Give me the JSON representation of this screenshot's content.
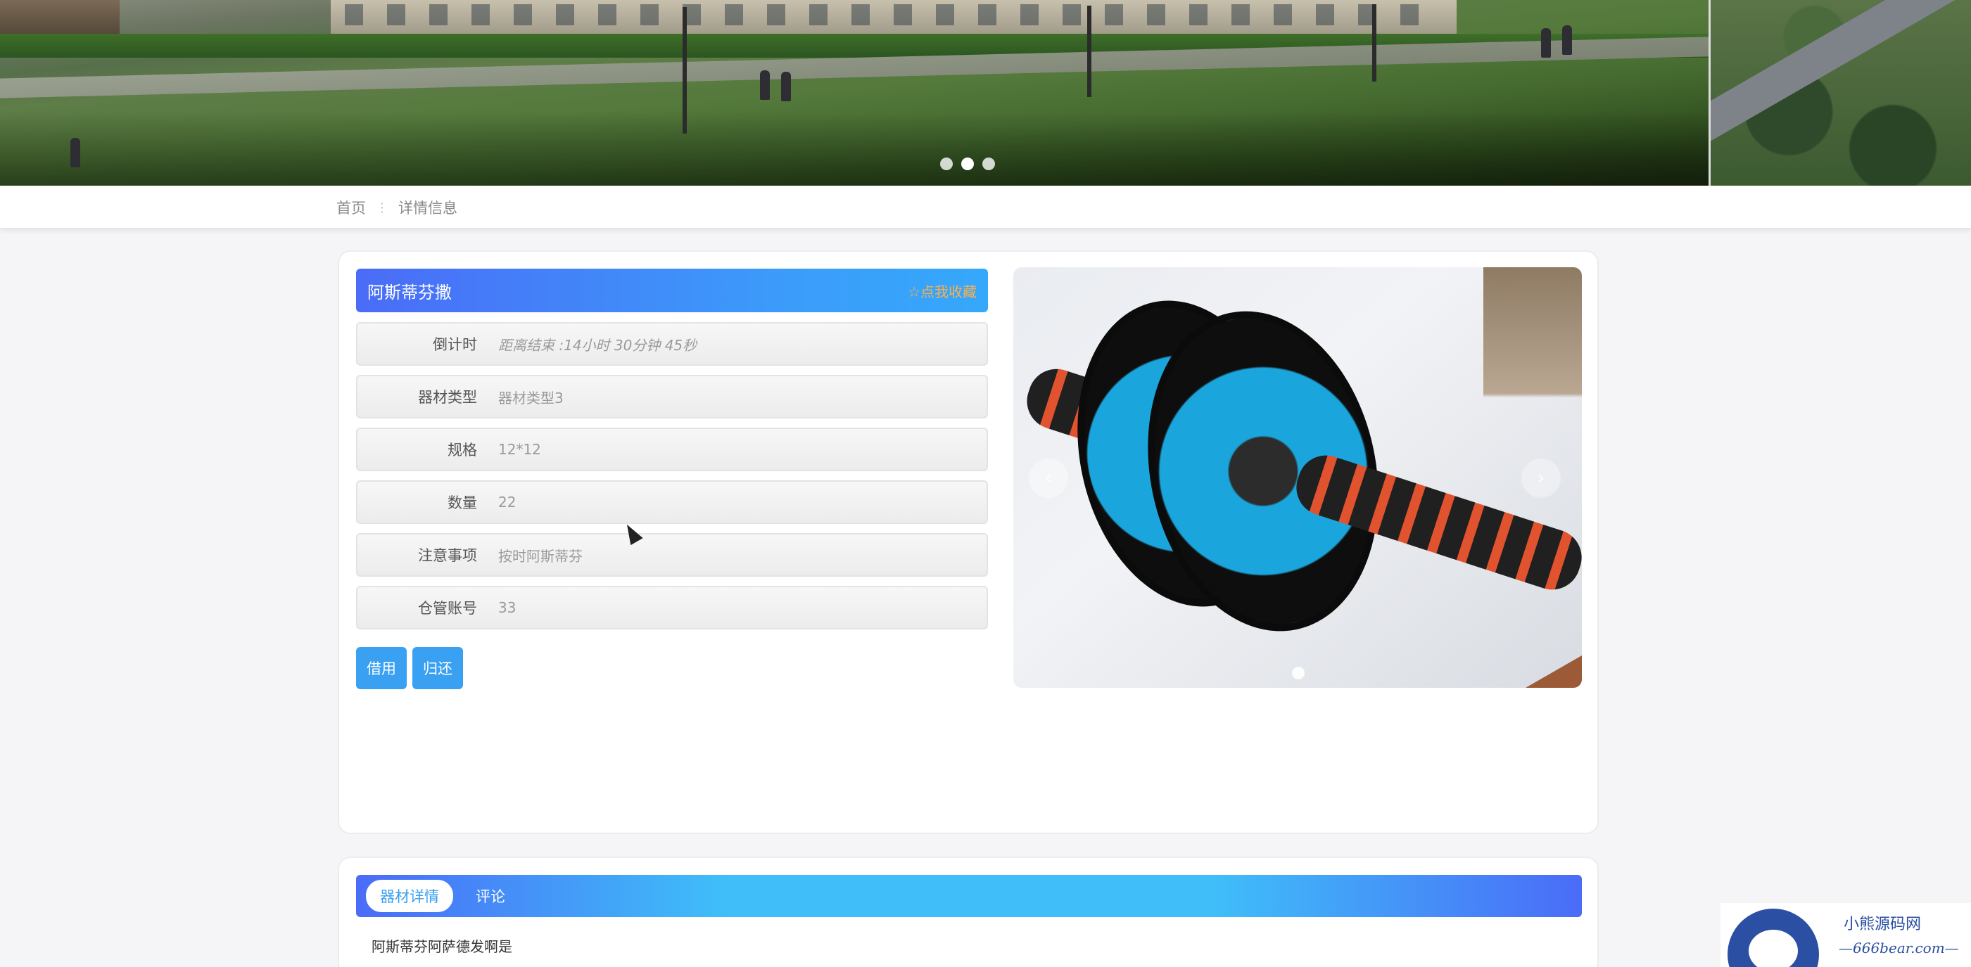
{
  "banner": {
    "dots": 3,
    "active_dot": 1
  },
  "breadcrumb": {
    "home": "首页",
    "separator": "⋮",
    "current": "详情信息"
  },
  "detail": {
    "name": "阿斯蒂芬撒",
    "favorite_label": "☆点我收藏",
    "rows": [
      {
        "label": "倒计时",
        "value": "距离结束 :14小时 30分钟 45秒"
      },
      {
        "label": "器材类型",
        "value": "器材类型3"
      },
      {
        "label": "规格",
        "value": "12*12"
      },
      {
        "label": "数量",
        "value": "22"
      },
      {
        "label": "注意事项",
        "value": "按时阿斯蒂芬"
      },
      {
        "label": "仓管账号",
        "value": "33"
      }
    ],
    "buttons": {
      "borrow": "借用",
      "return": "归还"
    },
    "image": {
      "prev_icon": "‹",
      "next_icon": "›"
    }
  },
  "tabs": {
    "items": [
      {
        "label": "器材详情",
        "active": true
      },
      {
        "label": "评论",
        "active": false
      }
    ],
    "description": "阿斯蒂芬阿萨德发啊是"
  },
  "watermark": {
    "line1": "小熊源码网",
    "line2": "—666bear.com—"
  },
  "colors": {
    "accent": "#3aa0f2",
    "title_gradient_start": "#4a6cf7",
    "favorite": "#ffb04a"
  }
}
